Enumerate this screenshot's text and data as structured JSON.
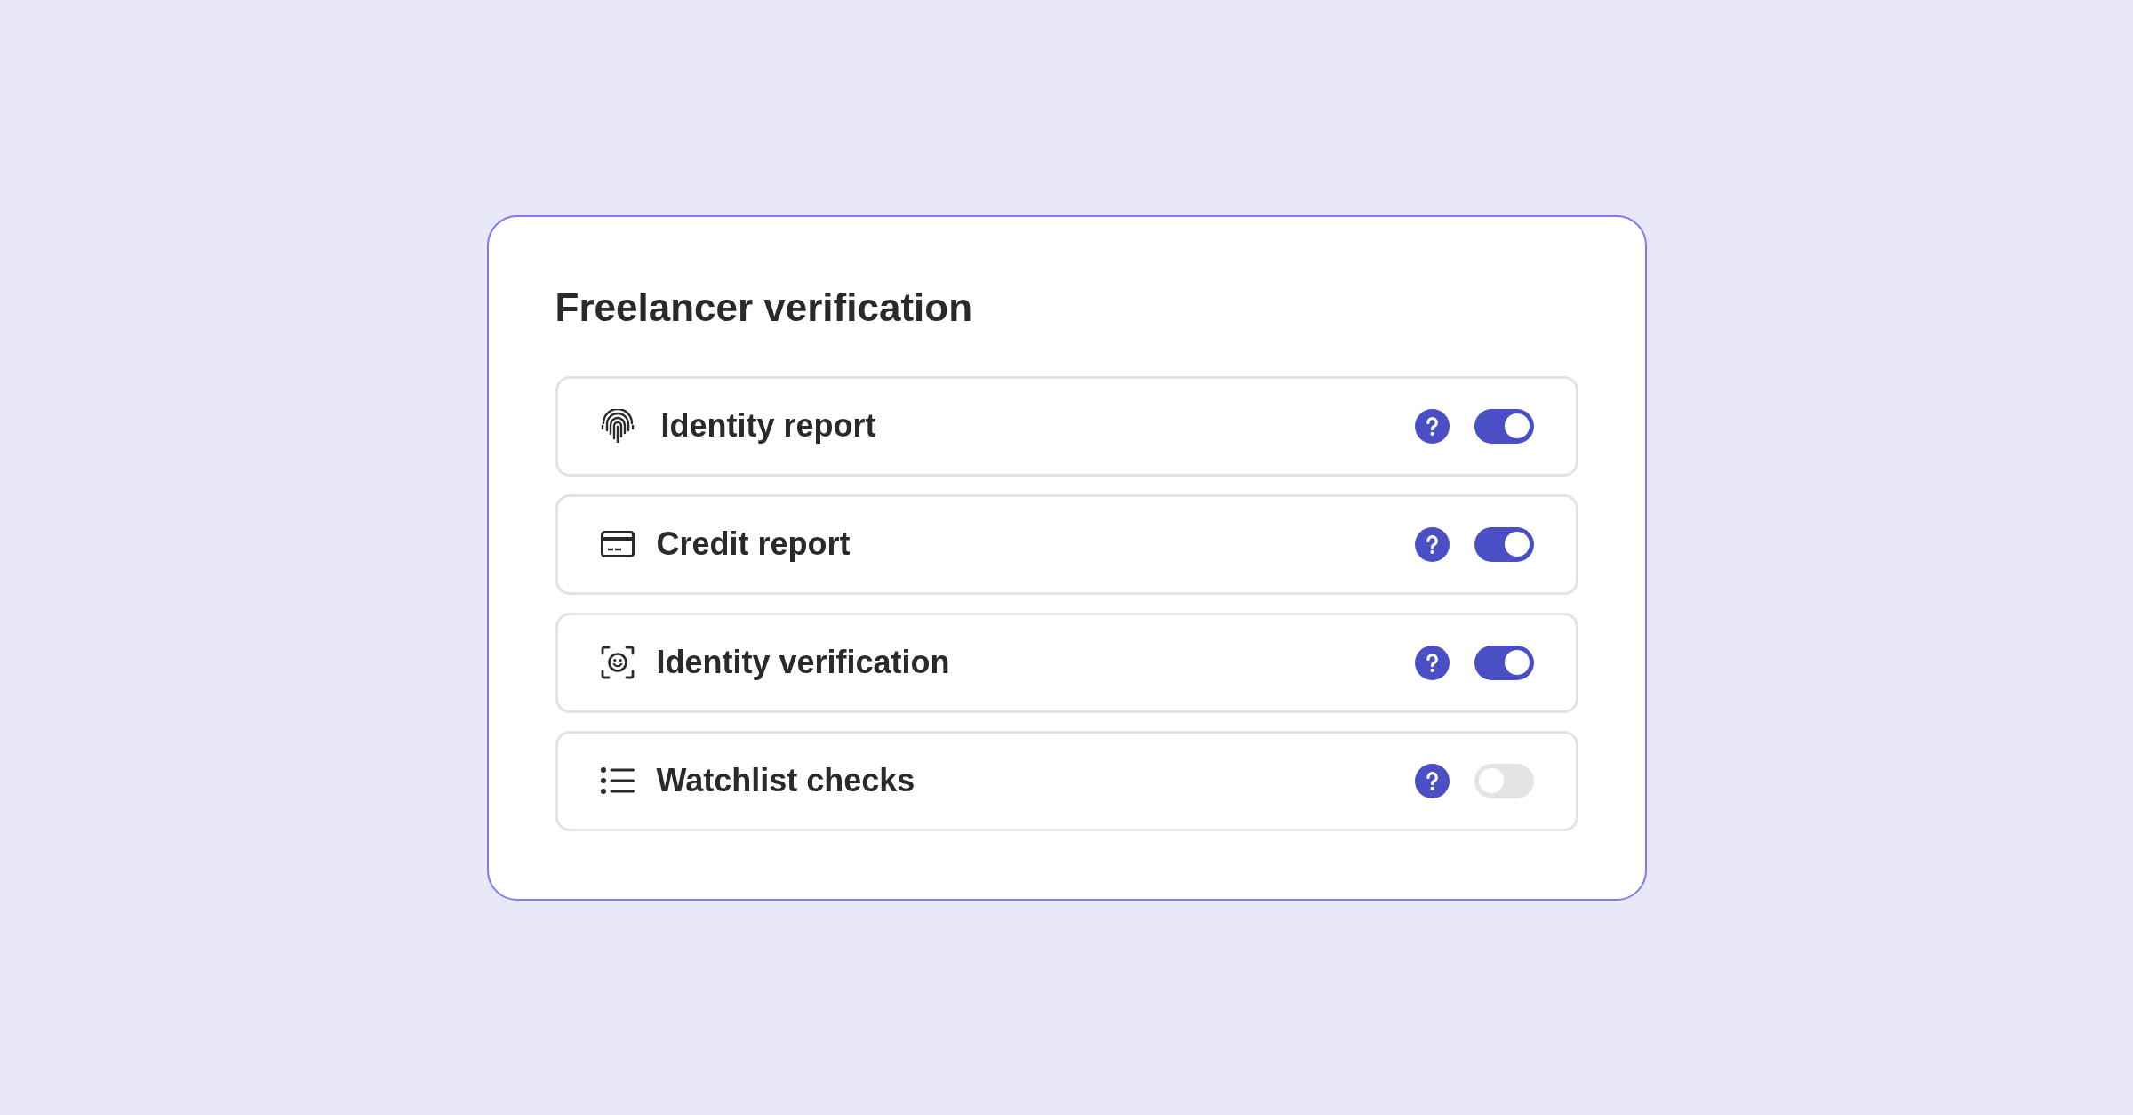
{
  "card": {
    "title": "Freelancer verification"
  },
  "checks": [
    {
      "label": "Identity report",
      "on": true
    },
    {
      "label": "Credit report",
      "on": true
    },
    {
      "label": "Identity verification",
      "on": true
    },
    {
      "label": "Watchlist checks",
      "on": false
    }
  ]
}
